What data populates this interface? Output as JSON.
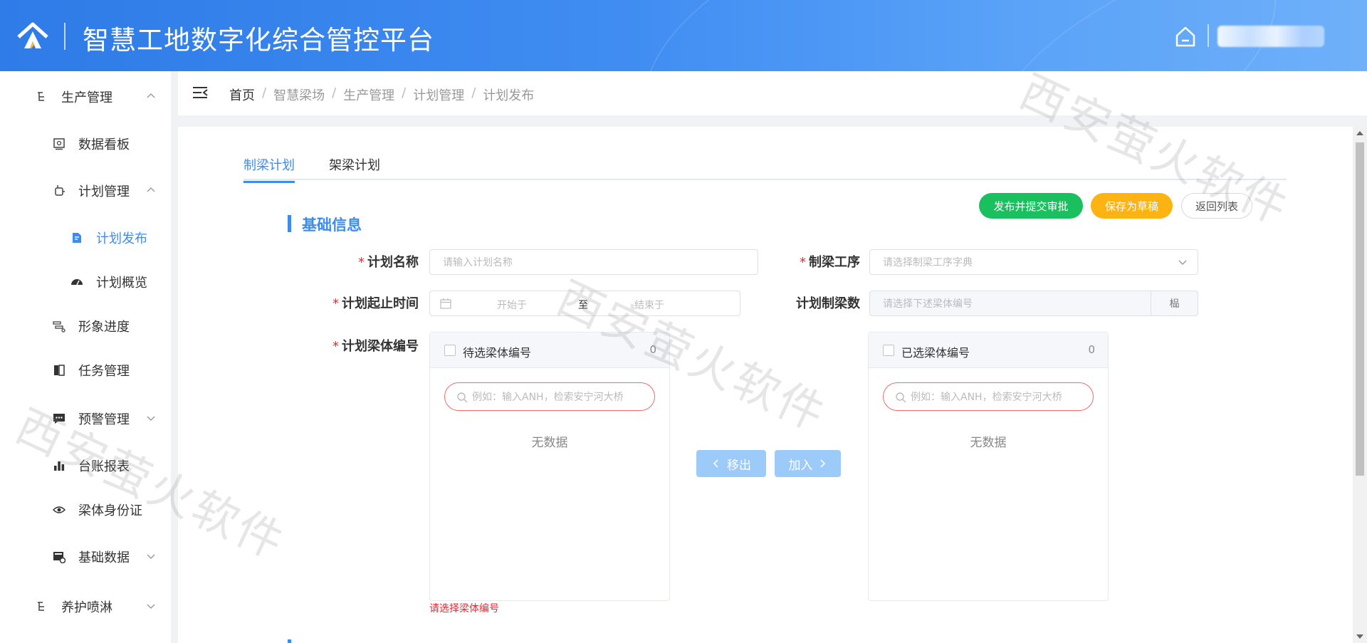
{
  "header": {
    "title": "智慧工地数字化综合管控平台"
  },
  "sidebar": {
    "items": [
      {
        "label": "生产管理"
      },
      {
        "label": "数据看板"
      },
      {
        "label": "计划管理"
      },
      {
        "label": "计划发布"
      },
      {
        "label": "计划概览"
      },
      {
        "label": "形象进度"
      },
      {
        "label": "任务管理"
      },
      {
        "label": "预警管理"
      },
      {
        "label": "台账报表"
      },
      {
        "label": "梁体身份证"
      },
      {
        "label": "基础数据"
      },
      {
        "label": "养护喷淋"
      }
    ]
  },
  "breadcrumb": [
    "首页",
    "/",
    "智慧梁场",
    "/",
    "生产管理",
    "/",
    "计划管理",
    "/",
    "计划发布"
  ],
  "tabs": [
    "制梁计划",
    "架梁计划"
  ],
  "actions": {
    "publish": "发布并提交审批",
    "draft": "保存为草稿",
    "back": "返回列表"
  },
  "section": {
    "title": "基础信息"
  },
  "form": {
    "plan_name": {
      "label": "计划名称",
      "placeholder": "请输入计划名称"
    },
    "process": {
      "label": "制梁工序",
      "placeholder": "请选择制梁工序字典"
    },
    "period": {
      "label": "计划起止时间",
      "start": "开始于",
      "sep": "至",
      "end": "结束于"
    },
    "count": {
      "label": "计划制梁数",
      "placeholder": "请选择下述梁体编号",
      "unit": "榀"
    },
    "beams": {
      "label": "计划梁体编号",
      "error": "请选择梁体编号"
    }
  },
  "transfer": {
    "left": {
      "title": "待选梁体编号",
      "count": "0",
      "search": "例如：输入ANH，检索安宁河大桥",
      "empty": "无数据"
    },
    "right": {
      "title": "已选梁体编号",
      "count": "0",
      "search": "例如：输入ANH，检索安宁河大桥",
      "empty": "无数据"
    },
    "remove": "移出",
    "add": "加入"
  },
  "watermark": "西安萤火软件",
  "colors": {
    "primary": "#3c8cf0",
    "publish": "#19c05d",
    "draft": "#fdb413",
    "error": "#f5222d"
  }
}
